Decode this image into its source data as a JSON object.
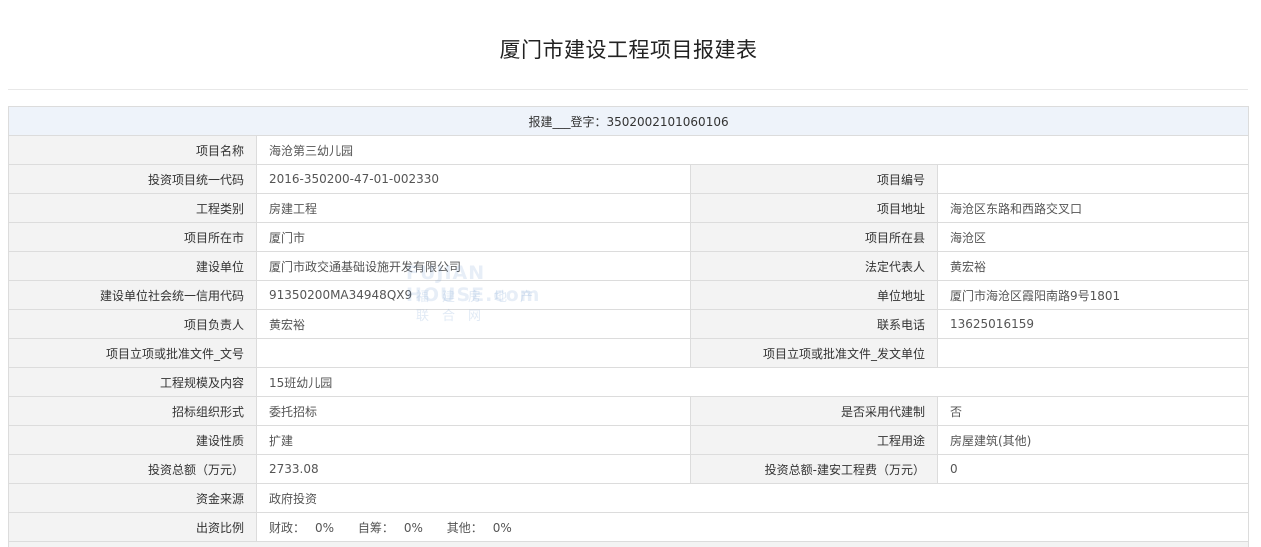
{
  "page": {
    "title": "厦门市建设工程项目报建表"
  },
  "header_row": {
    "text": "报建___登字：3502002101060106"
  },
  "fields": {
    "project_name_label": "项目名称",
    "project_name_value": "海沧第三幼儿园",
    "invest_code_label": "投资项目统一代码",
    "invest_code_value": "2016-350200-47-01-002330",
    "project_no_label": "项目编号",
    "project_no_value": "",
    "eng_type_label": "工程类别",
    "eng_type_value": "房建工程",
    "project_addr_label": "项目地址",
    "project_addr_value": "海沧区东路和西路交叉口",
    "city_label": "项目所在市",
    "city_value": "厦门市",
    "county_label": "项目所在县",
    "county_value": "海沧区",
    "builder_label": "建设单位",
    "builder_value": "厦门市政交通基础设施开发有限公司",
    "legal_rep_label": "法定代表人",
    "legal_rep_value": "黄宏裕",
    "credit_code_label": "建设单位社会统一信用代码",
    "credit_code_value": "91350200MA34948QX9",
    "unit_addr_label": "单位地址",
    "unit_addr_value": "厦门市海沧区霞阳南路9号1801",
    "leader_label": "项目负责人",
    "leader_value": "黄宏裕",
    "phone_label": "联系电话",
    "phone_value": "13625016159",
    "approval_doc_label": "项目立项或批准文件_文号",
    "approval_doc_value": "",
    "approval_unit_label": "项目立项或批准文件_发文单位",
    "approval_unit_value": "",
    "scale_label": "工程规模及内容",
    "scale_value": "15班幼儿园",
    "bidding_label": "招标组织形式",
    "bidding_value": "委托招标",
    "agent_label": "是否采用代建制",
    "agent_value": "否",
    "nature_label": "建设性质",
    "nature_value": "扩建",
    "usage_label": "工程用途",
    "usage_value": "房屋建筑(其他)",
    "total_invest_label": "投资总额（万元）",
    "total_invest_value": "2733.08",
    "install_cost_label": "投资总额-建安工程费（万元）",
    "install_cost_value": "0",
    "fund_source_label": "资金来源",
    "fund_source_value": "政府投资",
    "ratio_label": "出资比例"
  },
  "ratio": [
    {
      "label": "财政：",
      "value": "0%"
    },
    {
      "label": "自筹：",
      "value": "0%"
    },
    {
      "label": "其他：",
      "value": "0%"
    }
  ],
  "watermark": {
    "en": "FUJIAN HOUSE.com",
    "cn": "福建房地产联合网"
  },
  "colors": {
    "label_bg": "#f3f3f3",
    "header_bg": "#eef3fa",
    "border": "#dcdcdc"
  }
}
